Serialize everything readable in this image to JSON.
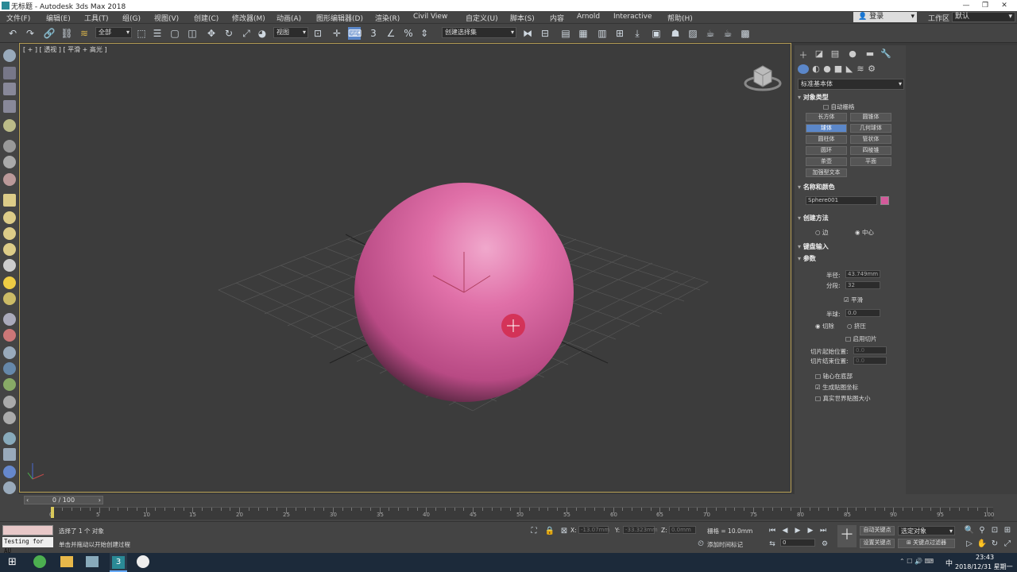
{
  "window": {
    "title": "无标题 - Autodesk 3ds Max 2018",
    "controls": [
      "—",
      "❐",
      "✕"
    ]
  },
  "menu": [
    "文件(F)",
    "编辑(E)",
    "工具(T)",
    "组(G)",
    "视图(V)",
    "创建(C)",
    "修改器(M)",
    "动画(A)",
    "图形编辑器(D)",
    "渲染(R)",
    "Civil View",
    "自定义(U)",
    "脚本(S)",
    "内容",
    "Arnold",
    "Interactive",
    "帮助(H)"
  ],
  "account": {
    "login": "登录",
    "workspace_label": "工作区",
    "workspace_value": "默认"
  },
  "toolbar": {
    "filter": "全部",
    "coord": "视图",
    "selset": "创建选择集"
  },
  "viewport": {
    "label": "[ + ] [ 透视 ] [ 平滑 + 高光 ]"
  },
  "command_panel": {
    "category": "标准基本体",
    "section_object_type": "对象类型",
    "autogrid": "自动栅格",
    "object_buttons": [
      "长方体",
      "圆锥体",
      "球体",
      "几何球体",
      "圆柱体",
      "管状体",
      "圆环",
      "四棱锥",
      "茶壶",
      "平面",
      "加强型文本"
    ],
    "selected_button": "球体",
    "section_name_color": "名称和颜色",
    "object_name": "Sphere001",
    "object_color": "#d45a9b",
    "section_creation": "创建方法",
    "creation_edge": "边",
    "creation_center": "中心",
    "section_keyboard": "键盘输入",
    "section_params": "参数",
    "radius_label": "半径:",
    "radius_value": "43.749mm",
    "segments_label": "分段:",
    "segments_value": "32",
    "smooth_label": "平滑",
    "hemisphere_label": "半球:",
    "hemisphere_value": "0.0",
    "chop_label": "切除",
    "squash_label": "挤压",
    "slice_on_label": "启用切片",
    "slice_from_label": "切片起始位置:",
    "slice_from_value": "0.0",
    "slice_to_label": "切片结束位置:",
    "slice_to_value": "0.0",
    "base_pivot_label": "轴心在底部",
    "gen_map_label": "生成贴图坐标",
    "real_world_label": "真实世界贴图大小"
  },
  "timeline": {
    "frame": "0 / 100",
    "ticks": [
      "0",
      "5",
      "10",
      "15",
      "20",
      "25",
      "30",
      "35",
      "40",
      "45",
      "50",
      "55",
      "60",
      "65",
      "70",
      "75",
      "80",
      "85",
      "90",
      "95",
      "100"
    ]
  },
  "status": {
    "script_label": "Testing for AU",
    "selection": "选择了 1 个 对象",
    "prompt": "单击并拖动以开始创建过程",
    "x_label": "X:",
    "x_value": "-13.07mm",
    "y_label": "Y:",
    "y_value": "-33.323mm",
    "z_label": "Z:",
    "z_value": "0.0mm",
    "grid": "栅格 = 10.0mm",
    "add_time_tag": "添加时间标记",
    "auto_key": "自动关键点",
    "set_key": "设置关键点",
    "selected_obj": "选定对象",
    "key_filters": "关键点过滤器",
    "frame_field": "0"
  },
  "taskbar": {
    "time": "23:43",
    "date": "2018/12/31 星期一",
    "ime": "中"
  }
}
